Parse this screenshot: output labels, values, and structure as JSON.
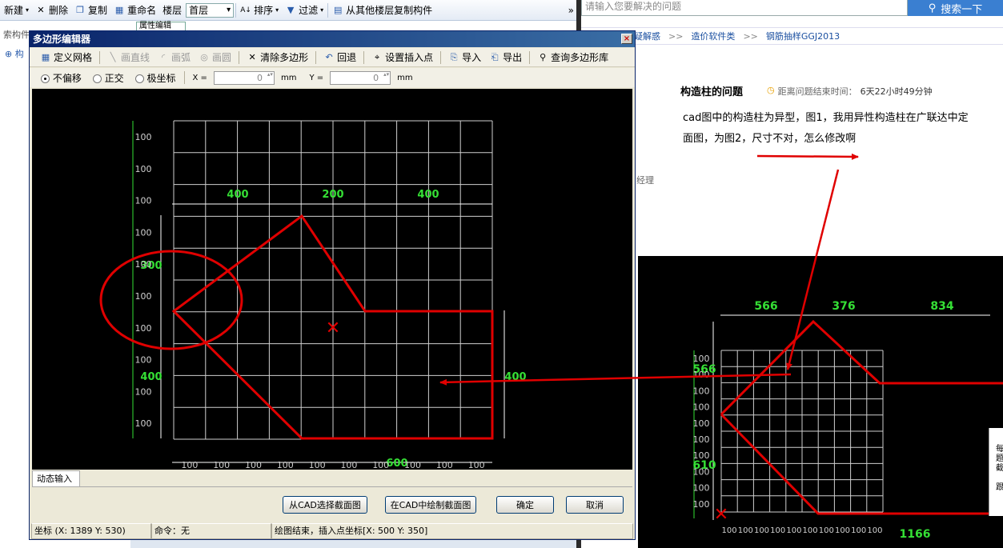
{
  "bg_app": {
    "toolbar": {
      "new": "新建",
      "delete": "删除",
      "copy": "复制",
      "rename": "重命名",
      "floor_label": "楼层",
      "floor_value": "首层",
      "sort": "排序",
      "filter": "过滤",
      "copy_from_floor": "从其他楼层复制构件",
      "overflow": "»"
    },
    "left_label": "索构件",
    "tree_root": "构",
    "props_tab": "属性编辑"
  },
  "web": {
    "search_placeholder": "请输入您要解决的问题",
    "search_button": "搜索一下",
    "breadcrumb": [
      "疑解惑",
      "造价软件类",
      "钢筋抽样GGJ2013"
    ],
    "breadcrumb_sep": ">>",
    "question_title": "构造柱的问题",
    "time_label": "距离问题结束时间：",
    "time_value": "6天22小时49分钟",
    "question_line1": "cad图中的构造柱为异型，图1，我用异性构造柱在广联达中定",
    "question_line2": "面图，为图2，尺寸不对，怎么修改啊",
    "manager": "经理",
    "side_chars": [
      "每",
      "题",
      "截",
      "跟"
    ]
  },
  "dialog": {
    "title": "多边形编辑器",
    "close": "×",
    "tools": {
      "define_grid": "定义网格",
      "draw_line": "画直线",
      "draw_arc": "画弧",
      "draw_circle": "画圆",
      "clear_polygon": "清除多边形",
      "undo": "回退",
      "set_insert_point": "设置插入点",
      "import": "导入",
      "export": "导出",
      "query_lib": "查询多边形库"
    },
    "options": {
      "no_offset": "不偏移",
      "ortho": "正交",
      "polar": "极坐标",
      "x_label": "X =",
      "x_value": "0",
      "y_label": "Y =",
      "y_value": "0",
      "unit": "mm"
    },
    "dynamic_input": "动态输入",
    "buttons": {
      "from_cad": "从CAD选择截面图",
      "draw_in_cad": "在CAD中绘制截面图",
      "ok": "确定",
      "cancel": "取消"
    },
    "status": {
      "coords": "坐标 (X: 1389 Y: 530)",
      "command": "命令：无",
      "message": "绘图结束，插入点坐标[X: 500 Y: 350]"
    },
    "canvas": {
      "left_ticks": [
        "100",
        "100",
        "100",
        "100",
        "100",
        "100",
        "100",
        "100",
        "100",
        "100"
      ],
      "bottom_ticks": [
        "100",
        "100",
        "100",
        "100",
        "100",
        "100",
        "100",
        "100",
        "100",
        "100"
      ],
      "top_dims": [
        "400",
        "200",
        "400"
      ],
      "left_dims": [
        "300",
        "400"
      ],
      "right_dim": "400",
      "bottom_dim": "600"
    }
  },
  "image2": {
    "top_dims": [
      "566",
      "376",
      "834"
    ],
    "left_dims": [
      "566",
      "610"
    ],
    "bottom_dim": "1166",
    "left_ticks": [
      "100",
      "100",
      "100",
      "100",
      "100",
      "100",
      "100",
      "100",
      "100",
      "100"
    ],
    "bottom_ticks": [
      "100",
      "100",
      "100",
      "100",
      "100",
      "100",
      "100",
      "100",
      "100",
      "100"
    ]
  },
  "colors": {
    "grid": "#d0d0d0",
    "dim_green": "#35e035",
    "shape_red": "#e00000",
    "annotation_red": "#e00000"
  }
}
